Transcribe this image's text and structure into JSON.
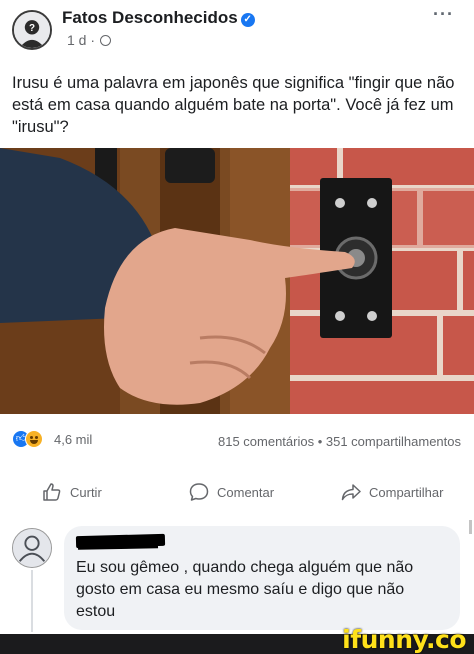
{
  "post": {
    "page_name": "Fatos Desconhecidos",
    "verified_icon": "verified-badge-icon",
    "time": "1 d",
    "separator": "·",
    "privacy_icon": "globe-icon",
    "more_label": "···",
    "text": "Irusu é uma palavra em japonês que significa \"fingir que não está em casa quando alguém bate na porta\". Você já fez um \"irusu\"?"
  },
  "photo": {
    "subject_icon": "photo-hand-doorbell"
  },
  "stats": {
    "reaction_icons": [
      "like-icon",
      "haha-icon"
    ],
    "reaction_count": "4,6 mil",
    "engagement": "815 comentários • 351 compartilhamentos"
  },
  "actions": {
    "like": "Curtir",
    "comment": "Comentar",
    "share": "Compartilhar"
  },
  "comment": {
    "text": "Eu sou gêmeo , quando chega alguém que não gosto em casa eu mesmo saíu  e digo que não estou"
  },
  "watermark": {
    "text": "ifunny.co"
  },
  "colors": {
    "accent": "#1877f2",
    "text": "#1c1e21",
    "muted": "#65676b",
    "bubble": "#f0f2f5",
    "watermark": "#ffe11a"
  }
}
